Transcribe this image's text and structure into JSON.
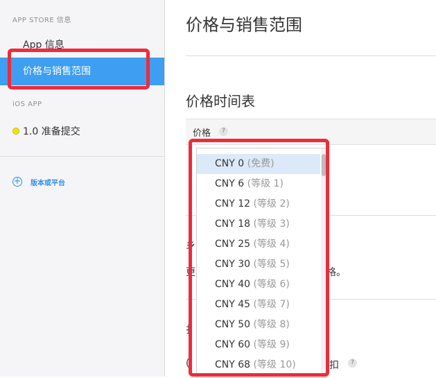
{
  "sidebar": {
    "section_app_store": "APP STORE 信息",
    "items": [
      {
        "label": "App 信息"
      },
      {
        "label": "价格与销售范围"
      }
    ],
    "section_ios": "iOS APP",
    "ios_item": {
      "label": "1.0 准备提交",
      "status_color": "#f5e300"
    },
    "add_platform_label": "版本或平台"
  },
  "main": {
    "page_title": "价格与销售范围",
    "section_title": "价格时间表",
    "table_header": {
      "price_label": "价格",
      "help_glyph": "?"
    },
    "partial_texts": {
      "left_a": "乡",
      "left_b": "更",
      "right_b": "格。",
      "left_c": "扌",
      "left_d": "(",
      "right_d": "扣",
      "help_glyph": "?"
    }
  },
  "dropdown": {
    "selected_index": 0,
    "options": [
      {
        "price": "CNY 0",
        "tier": "(免费)"
      },
      {
        "price": "CNY 6",
        "tier": "(等级 1)"
      },
      {
        "price": "CNY 12",
        "tier": "(等级 2)"
      },
      {
        "price": "CNY 18",
        "tier": "(等级 3)"
      },
      {
        "price": "CNY 25",
        "tier": "(等级 4)"
      },
      {
        "price": "CNY 30",
        "tier": "(等级 5)"
      },
      {
        "price": "CNY 40",
        "tier": "(等级 6)"
      },
      {
        "price": "CNY 45",
        "tier": "(等级 7)"
      },
      {
        "price": "CNY 50",
        "tier": "(等级 8)"
      },
      {
        "price": "CNY 60",
        "tier": "(等级 9)"
      },
      {
        "price": "CNY 68",
        "tier": "(等级 10)"
      }
    ]
  },
  "colors": {
    "accent": "#3d9ef2",
    "highlight_box": "#ef2b3a",
    "link": "#2d8ef0"
  }
}
